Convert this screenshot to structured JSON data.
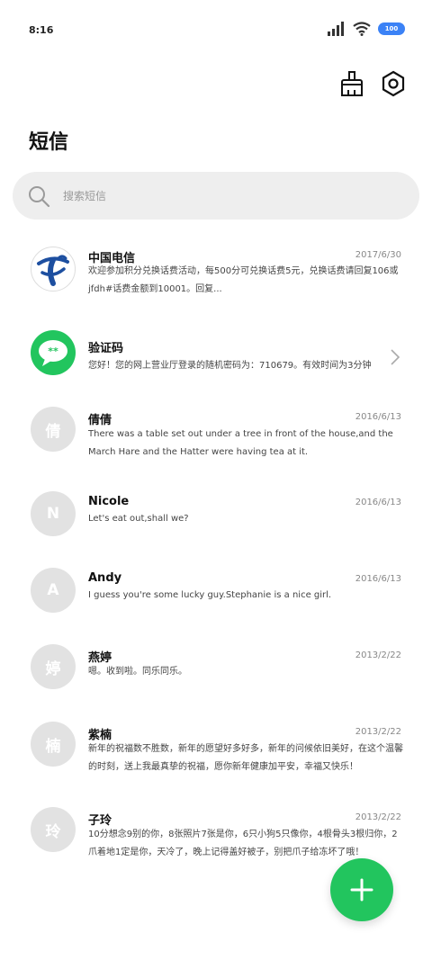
{
  "status": {
    "time": "8:16",
    "battery": "100"
  },
  "toolbar": {
    "brush_icon": "brush-icon",
    "settings_icon": "settings-icon"
  },
  "title": "短信",
  "search": {
    "placeholder": "搜索短信"
  },
  "messages": [
    {
      "sender": "中国电信",
      "date": "2017/6/30",
      "preview": "欢迎参加积分兑换话费活动，每500分可兑换话费5元，兑换话费请回复106或jfdh#话费金额到10001。回复...",
      "avatar": ""
    },
    {
      "sender": "验证码",
      "date": "",
      "preview": "您好！您的网上营业厅登录的随机密码为：710679。有效时间为3分钟",
      "avatar": "**"
    },
    {
      "sender": "倩倩",
      "date": "2016/6/13",
      "preview": "There was a table set out under a tree in front of the house,and the March Hare and the Hatter were having tea at it.",
      "avatar": "倩"
    },
    {
      "sender": "Nicole",
      "date": "2016/6/13",
      "preview": "Let's eat out,shall we?",
      "avatar": "N"
    },
    {
      "sender": "Andy",
      "date": "2016/6/13",
      "preview": "I guess you're some lucky guy.Stephanie is a nice girl.",
      "avatar": "A"
    },
    {
      "sender": "燕婷",
      "date": "2013/2/22",
      "preview": "嗯。收到啦。同乐同乐。",
      "avatar": "婷"
    },
    {
      "sender": "紫楠",
      "date": "2013/2/22",
      "preview": "新年的祝福数不胜数，新年的愿望好多好多，新年的问候依旧美好，在这个温馨的时刻，送上我最真挚的祝福，愿你新年健康加平安，幸福又快乐！",
      "avatar": "楠"
    },
    {
      "sender": "子玲",
      "date": "2013/2/22",
      "preview": "10分想念9别的你，8张照片7张是你，6只小狗5只像你，4根骨头3根归你，2爪着地1定是你，天冷了，晚上记得盖好被子，别把爪子给冻坏了哦！",
      "avatar": "玲"
    }
  ],
  "colors": {
    "accent": "#22c55e",
    "telecom_blue": "#1d4fa0",
    "avatar_gray": "#e2e2e2",
    "battery": "#3b82f6"
  }
}
